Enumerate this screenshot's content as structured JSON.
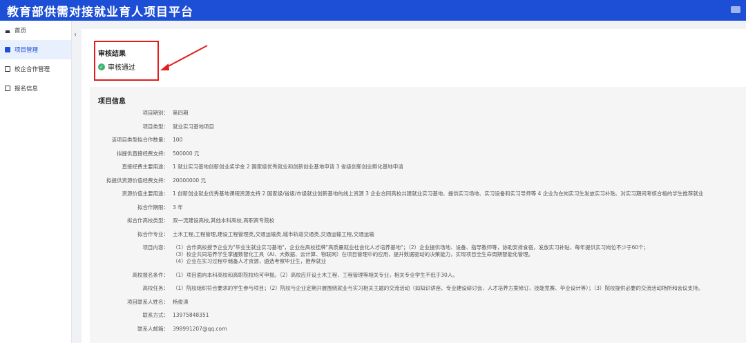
{
  "header": {
    "title": "教育部供需对接就业育人项目平台"
  },
  "sidebar": {
    "items": [
      {
        "label": "首页",
        "icon": "home-icon",
        "active": false
      },
      {
        "label": "项目管理",
        "icon": "list-icon",
        "active": true
      },
      {
        "label": "校企合作管理",
        "icon": "document-icon",
        "active": false
      },
      {
        "label": "报名信息",
        "icon": "card-icon",
        "active": false
      }
    ],
    "collapse_glyph": "‹"
  },
  "audit": {
    "title": "审核结果",
    "status": "审核通过"
  },
  "project": {
    "title": "项目信息",
    "rows": [
      {
        "label": "项目期别：",
        "value": "第四期"
      },
      {
        "label": "项目类型：",
        "value": "就业实习基地项目"
      },
      {
        "label": "该项目类型拟合作数量：",
        "value": "100"
      },
      {
        "label": "拟提供直接经费支持：",
        "value": "500000 元"
      },
      {
        "label": "直接经费主要用途：",
        "value": "1 就业实习基地创新创业奖学金 2 国家级优秀就业和创新创业基地申请 3 省级创新创业孵化基地申请"
      },
      {
        "label": "拟提供资源价值经费支持：",
        "value": "20000000 元"
      },
      {
        "label": "资源价值主要用途：",
        "value": "1 创新创业就业优秀基地课程资源支持 2 国家级/省级/市级就业创新基地的线上资源 3 企业合同高校共建就业实习基地、提供实习场地、实习设备和实习导师等 4 企业为在岗实习生发放实习补贴、对实习期间考核合格的学生推荐就业"
      },
      {
        "label": "拟合作期限：",
        "value": "3 年"
      },
      {
        "label": "拟合作高校类型：",
        "value": "双一流建设高校,其他本科高校,高职高专院校"
      },
      {
        "label": "拟合作专业：",
        "value": "土木工程,工程管理,建设工程管理类,交通运输类,城市轨道交通类,交通运输工程,交通运输"
      },
      {
        "label": "项目内容：",
        "lines": [
          "（1）合作高校授予企业为\"毕业生就业实习基地\"，企业在高校挂牌\"高质量就业社会化人才培养基地\"；（2）企业提供场地、设备、指导教师等，协助安排食宿，发放实习补贴，每年提供实习岗位不少于60个；",
          "（3）校企共同培养学生掌握数智化工具（AI、大数据、云计算、物联网）在项目管理中的应用，提升数据驱动的决策能力，实现项目全生命周期智能化管理。",
          "（4）企业在实习过程中储备人才资源，遴选考察毕业生，推荐就业"
        ]
      },
      {
        "label": "高校报名条件：",
        "value": "（1）项目面向本科高校和高职院校均可申报。（2）高校应开设土木工程、工程管理等相关专业，相关专业学生不低于30人。"
      },
      {
        "label": "高校任务：",
        "value": "（1）院校组织符合要求的学生参与项目；（2）院校与企业定期开展围绕就业与实习相关主题的交流活动（如知识讲座、专业建设研讨会、人才培养方案修订、技能竞赛、毕业设计等）；（3）院校提供必要的交流活动场所和会议支持。"
      },
      {
        "label": "项目联系人姓名：",
        "value": "杨俊涛"
      },
      {
        "label": "联系方式：",
        "value": "13975848351"
      },
      {
        "label": "联系人邮箱：",
        "value": "398991207@qq.com"
      }
    ]
  }
}
